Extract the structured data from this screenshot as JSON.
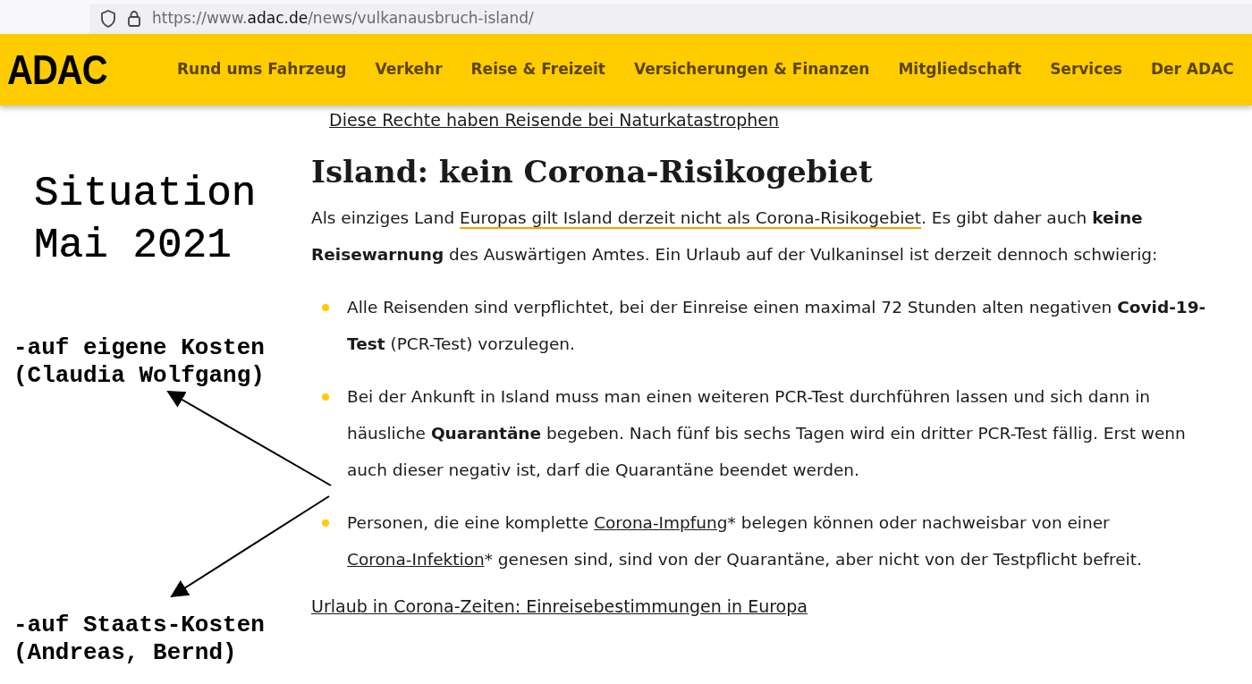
{
  "browser": {
    "url_host_prefix": "https://www.",
    "url_host": "adac.de",
    "url_path": "/news/vulkanausbruch-island/"
  },
  "header": {
    "logo": "ADAC",
    "nav": [
      {
        "label": "Rund ums Fahrzeug"
      },
      {
        "label": "Verkehr"
      },
      {
        "label": "Reise & Freizeit"
      },
      {
        "label": "Versicherungen & Finanzen"
      },
      {
        "label": "Mitgliedschaft"
      },
      {
        "label": "Services"
      },
      {
        "label": "Der ADAC"
      }
    ]
  },
  "annotations": {
    "title_lines": [
      "Situation",
      "Mai 2021"
    ],
    "notes": [
      {
        "lines": [
          "-auf eigene Kosten",
          "(Claudia Wolfgang)"
        ]
      },
      {
        "lines": [
          "-auf Staats-Kosten",
          "(Andreas, Bernd)"
        ]
      }
    ]
  },
  "article": {
    "top_link": "Diese Rechte haben Reisende bei Naturkatastrophen",
    "heading": "Island: kein Corona-Risikogebiet",
    "intro": [
      {
        "kind": "plain",
        "text": "Als einziges Land "
      },
      {
        "kind": "highlight",
        "text": "Europas gilt Island derzeit nicht als Corona-Risikogebiet"
      },
      {
        "kind": "plain",
        "text": ". Es gibt daher auch "
      },
      {
        "kind": "bold",
        "text": "keine Reisewarnung"
      },
      {
        "kind": "plain",
        "text": " des Auswärtigen Amtes. Ein Urlaub auf der Vulkaninsel ist derzeit dennoch schwierig:"
      }
    ],
    "bullets": [
      [
        {
          "kind": "plain",
          "text": "Alle Reisenden sind verpflichtet, bei der Einreise einen maximal 72 Stunden alten negativen "
        },
        {
          "kind": "bold",
          "text": "Covid-19-Test"
        },
        {
          "kind": "plain",
          "text": " (PCR-Test) vorzulegen."
        }
      ],
      [
        {
          "kind": "plain",
          "text": "Bei der Ankunft in Island muss man einen weiteren PCR-Test durchführen lassen und sich dann in häusliche "
        },
        {
          "kind": "bold",
          "text": "Quarantäne"
        },
        {
          "kind": "plain",
          "text": " begeben. Nach fünf bis sechs Tagen wird ein dritter PCR-Test fällig. Erst wenn auch dieser negativ ist, darf die Quarantäne beendet werden."
        }
      ],
      [
        {
          "kind": "plain",
          "text": "Personen, die eine komplette "
        },
        {
          "kind": "link",
          "text": "Corona-Impfung"
        },
        {
          "kind": "plain",
          "text": "* belegen können oder nachweisbar von einer "
        },
        {
          "kind": "link",
          "text": "Corona-Infektion"
        },
        {
          "kind": "plain",
          "text": "* genesen sind, sind von der Quarantäne, aber nicht von der Testpflicht befreit."
        }
      ]
    ],
    "bottom_link": "Urlaub in Corona-Zeiten: Einreisebestimmungen in Europa"
  }
}
